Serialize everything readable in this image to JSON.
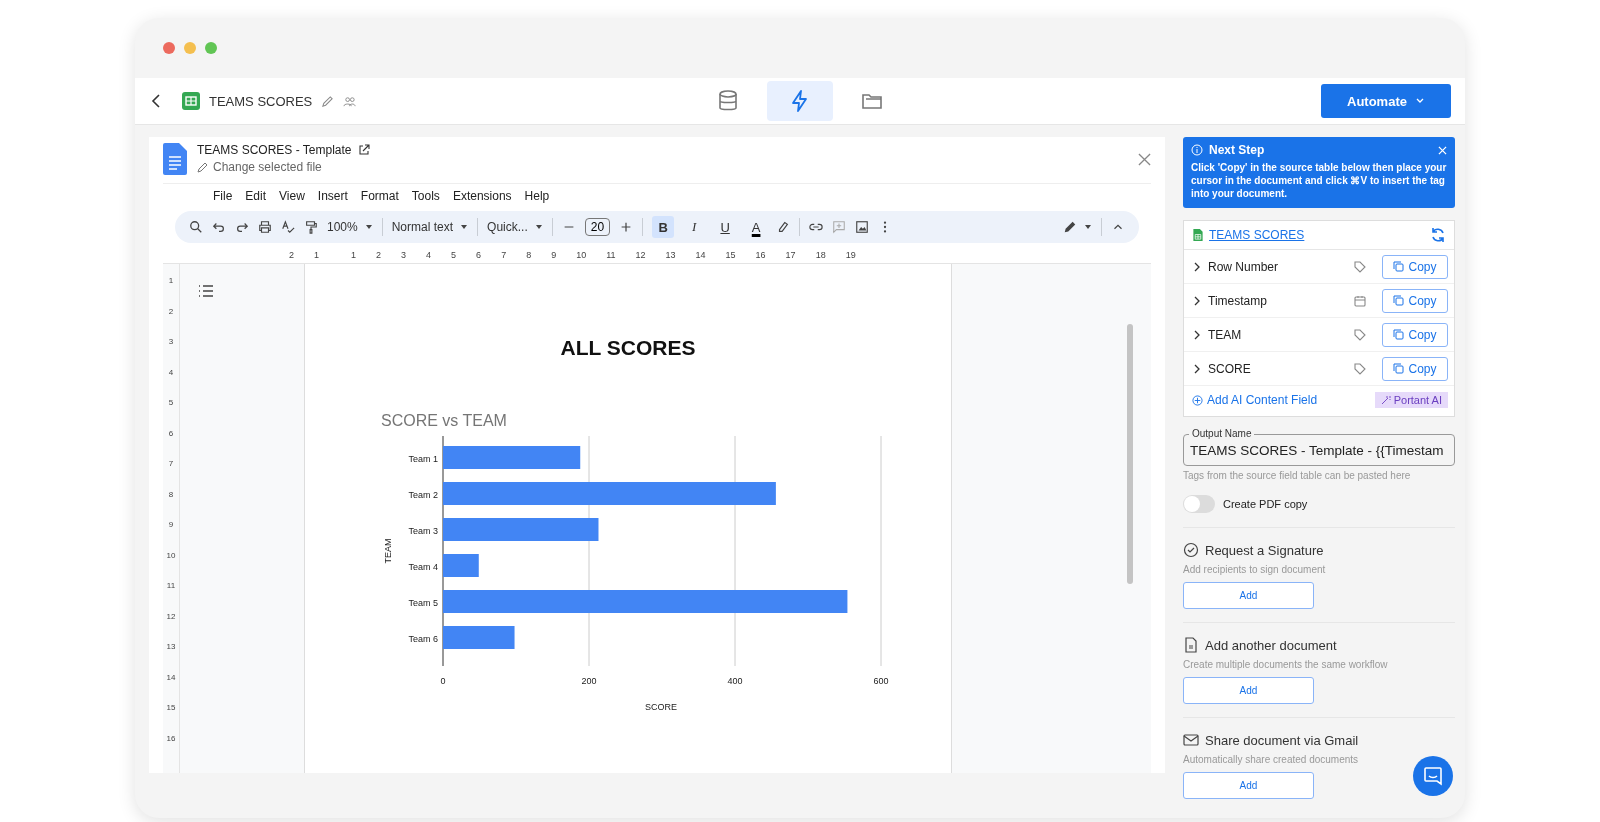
{
  "header": {
    "title": "TEAMS SCORES",
    "tabs": [
      {
        "kind": "database",
        "selected": false
      },
      {
        "kind": "bolt",
        "selected": true
      },
      {
        "kind": "folder",
        "selected": false
      }
    ],
    "automate_button": "Automate"
  },
  "document": {
    "title": "TEAMS SCORES - Template",
    "change_link": "Change selected file",
    "menu": [
      "File",
      "Edit",
      "View",
      "Insert",
      "Format",
      "Tools",
      "Extensions",
      "Help"
    ],
    "toolbar": {
      "zoom": "100%",
      "style": "Normal text",
      "font": "Quick...",
      "font_size": "20",
      "format_buttons": [
        {
          "label": "B",
          "selected": true
        },
        {
          "label": "I",
          "selected": false
        },
        {
          "label": "U",
          "selected": false
        },
        {
          "label": "A",
          "selected": false
        }
      ]
    },
    "ruler": [
      "2",
      "1",
      "1",
      "2",
      "3",
      "4",
      "5",
      "6",
      "7",
      "8",
      "9",
      "10",
      "11",
      "12",
      "13",
      "14",
      "15",
      "16",
      "17",
      "18",
      "19"
    ],
    "vertical_ruler": [
      "1",
      "2",
      "3",
      "4",
      "5",
      "6",
      "7",
      "8",
      "9",
      "10",
      "11",
      "12",
      "13",
      "14",
      "15",
      "16"
    ],
    "heading": "ALL SCORES",
    "chart_data": {
      "type": "bar",
      "orientation": "horizontal",
      "title": "SCORE vs TEAM",
      "xlabel": "SCORE",
      "ylabel": "TEAM",
      "categories": [
        "Team 1",
        "Team 2",
        "Team 3",
        "Team 4",
        "Team 5",
        "Team 6"
      ],
      "series": [
        {
          "color": "#4285f4",
          "values": [
            188,
            456,
            213,
            49,
            554,
            98
          ]
        }
      ],
      "xlim": [
        0,
        600
      ],
      "xticks": [
        0,
        200,
        400,
        600
      ]
    }
  },
  "panel": {
    "next_step": {
      "title": "Next Step",
      "message": "Click 'Copy' in the source table below then place your cursor in the document and click ⌘V to insert the tag into your document."
    },
    "source": {
      "title": "TEAMS SCORES",
      "fields": [
        {
          "name": "Row Number",
          "kind": "tag",
          "button": "Copy"
        },
        {
          "name": "Timestamp",
          "kind": "date",
          "button": "Copy"
        },
        {
          "name": "TEAM",
          "kind": "tag",
          "button": "Copy"
        },
        {
          "name": "SCORE",
          "kind": "tag",
          "button": "Copy"
        }
      ],
      "add_ai": "Add AI Content Field",
      "ai_badge": "Portant AI"
    },
    "output": {
      "label": "Output Name",
      "value": "TEAMS SCORES - Template - {{Timestam",
      "hint": "Tags from the source field table can be pasted here"
    },
    "pdf_toggle": {
      "label": "Create PDF copy",
      "on": false
    },
    "sections": [
      {
        "kind": "signature",
        "title": "Request a Signature",
        "description": "Add recipients to sign document",
        "button": "Add"
      },
      {
        "kind": "document",
        "title": "Add another document",
        "description": "Create multiple documents the same workflow",
        "button": "Add"
      },
      {
        "kind": "mail",
        "title": "Share document via Gmail",
        "description": "Automatically share created documents",
        "button": "Add"
      }
    ]
  }
}
